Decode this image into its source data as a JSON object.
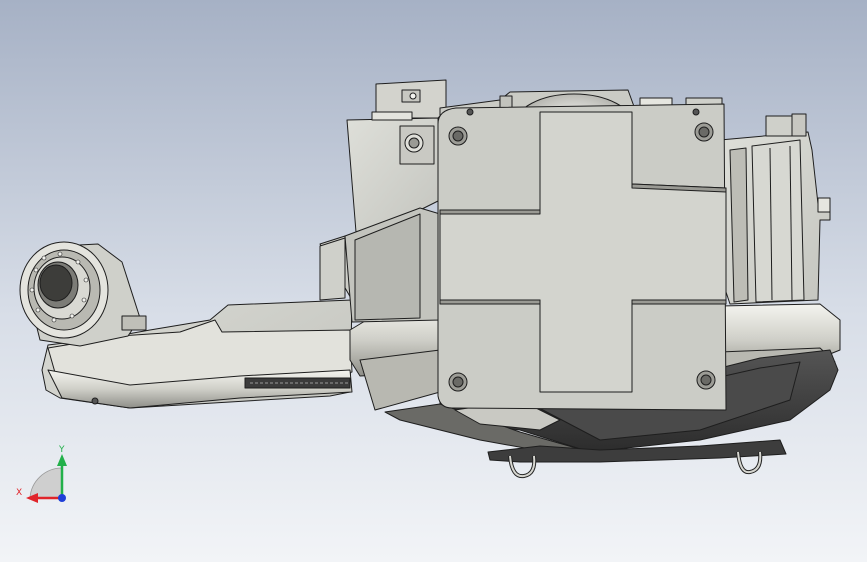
{
  "viewport": {
    "background_top": "#a6b1c5",
    "background_bottom": "#f2f4f7",
    "model_fill": "#d6d6d0",
    "model_dark": "#3a3a3a",
    "edge_color": "#1e1e1e"
  },
  "triad": {
    "x_label": "X",
    "y_label": "Y",
    "x_color": "#e0242a",
    "y_color": "#22b04a",
    "z_color": "#1f3fd8"
  },
  "icons": [
    "coordinate-triad-icon"
  ]
}
